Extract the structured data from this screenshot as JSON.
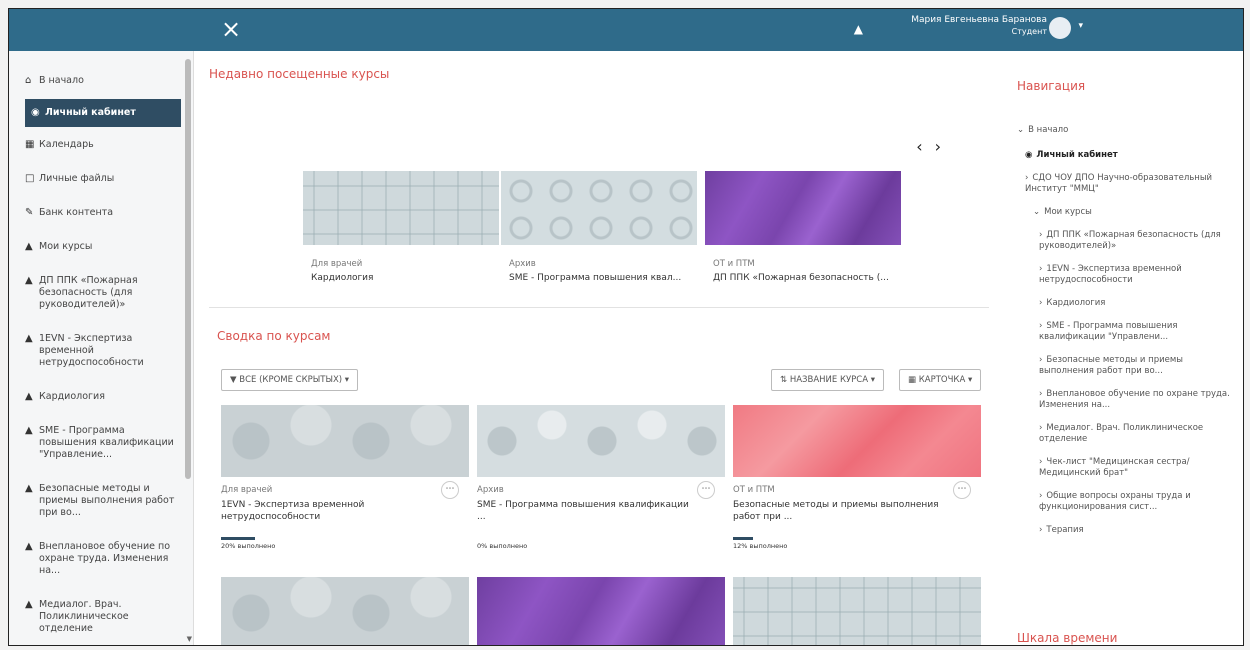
{
  "topbar": {
    "close_glyph": "×",
    "user_name": "Мария Евгеньевна Баранова",
    "user_role": "Студент",
    "caret": "▾"
  },
  "drawer": {
    "items": [
      {
        "icon": "home-icon",
        "label": "В начало"
      },
      {
        "icon": "dashboard-icon",
        "label": "Личный кабинет",
        "active": true
      },
      {
        "icon": "calendar-icon",
        "label": "Календарь"
      },
      {
        "icon": "file-icon",
        "label": "Личные файлы"
      },
      {
        "icon": "pen-icon",
        "label": "Банк контента"
      },
      {
        "icon": "graduation-cap-icon",
        "label": "Мои курсы"
      },
      {
        "icon": "graduation-cap-icon",
        "label": "ДП ППК «Пожарная безопасность (для руководителей)»"
      },
      {
        "icon": "graduation-cap-icon",
        "label": "1EVN - Экспертиза временной нетрудоспособности"
      },
      {
        "icon": "graduation-cap-icon",
        "label": "Кардиология"
      },
      {
        "icon": "graduation-cap-icon",
        "label": "SME - Программа повышения квалификации \"Управление..."
      },
      {
        "icon": "graduation-cap-icon",
        "label": "Безопасные методы и приемы выполнения работ при во..."
      },
      {
        "icon": "graduation-cap-icon",
        "label": "Внеплановое обучение по охране труда. Изменения на..."
      },
      {
        "icon": "graduation-cap-icon",
        "label": "Медиалог. Врач. Поликлиническое отделение"
      }
    ]
  },
  "recent": {
    "title": "Недавно посещенные курсы",
    "prev": "‹",
    "next": "›",
    "cards": [
      {
        "category": "Для врачей",
        "name": "Кардиология"
      },
      {
        "category": "Архив",
        "name": "SME - Программа повышения квал..."
      },
      {
        "category": "ОТ и ПТМ",
        "name": "ДП ППК «Пожарная безопасность (..."
      }
    ]
  },
  "overview": {
    "title": "Сводка по курсам",
    "filter_label": "ВСЕ (КРОМЕ СКРЫТЫХ)",
    "sort_label": "НАЗВАНИЕ КУРСА",
    "view_label": "КАРТОЧКА",
    "cards": [
      {
        "category": "Для врачей",
        "name": "1EVN - Экспертиза временной нетрудоспособности",
        "progress": "20% выполнено",
        "progress_value": 20
      },
      {
        "category": "Архив",
        "name": "SME - Программа повышения квалификации ...",
        "progress": "0% выполнено",
        "progress_value": 0
      },
      {
        "category": "ОТ и ПТМ",
        "name": "Безопасные методы и приемы выполнения работ при ...",
        "progress": "12% выполнено",
        "progress_value": 12
      }
    ]
  },
  "navigation": {
    "title": "Навигация",
    "timeline_title": "Шкала времени",
    "home": "В начало",
    "dashboard": "Личный кабинет",
    "site": "СДО ЧОУ ДПО Научно-образовательный Институт \"ММЦ\"",
    "my_courses": "Мои курсы",
    "courses": [
      "ДП ППК «Пожарная безопасность (для руководителей)»",
      "1EVN - Экспертиза временной нетрудоспособности",
      "Кардиология",
      "SME - Программа повышения квалификации \"Управлени...",
      "Безопасные методы и приемы выполнения работ при во...",
      "Внеплановое обучение по охране труда. Изменения на...",
      "Медиалог. Врач. Поликлиническое отделение",
      "Чек-лист \"Медицинская сестра/Медицинский брат\"",
      "Общие вопросы охраны труда и функционирования сист...",
      "Терапия"
    ]
  },
  "colors": {
    "topbar": "#2f6b8a",
    "accent": "#d9534f",
    "active_nav": "#2f4d63"
  }
}
